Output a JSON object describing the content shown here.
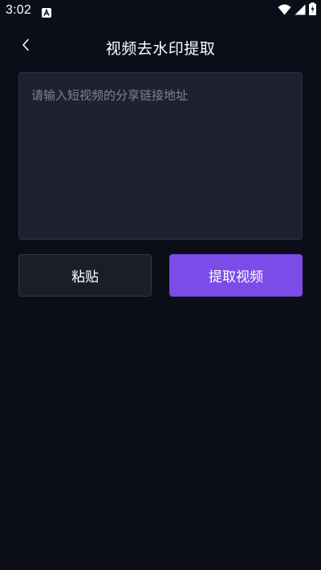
{
  "status_bar": {
    "time": "3:02",
    "notification_icon": "a-letter-icon",
    "wifi_icon": "wifi-icon",
    "signal_icon": "signal-icon",
    "battery_icon": "battery-charging-icon"
  },
  "header": {
    "back_icon": "chevron-left-icon",
    "title": "视频去水印提取"
  },
  "input": {
    "value": "",
    "placeholder": "请输入短视频的分享链接地址"
  },
  "buttons": {
    "paste_label": "粘贴",
    "extract_label": "提取视频"
  },
  "colors": {
    "background": "#0b0e18",
    "input_background": "#1e2130",
    "paste_button": "#1b1e29",
    "accent": "#7a4ce8"
  }
}
